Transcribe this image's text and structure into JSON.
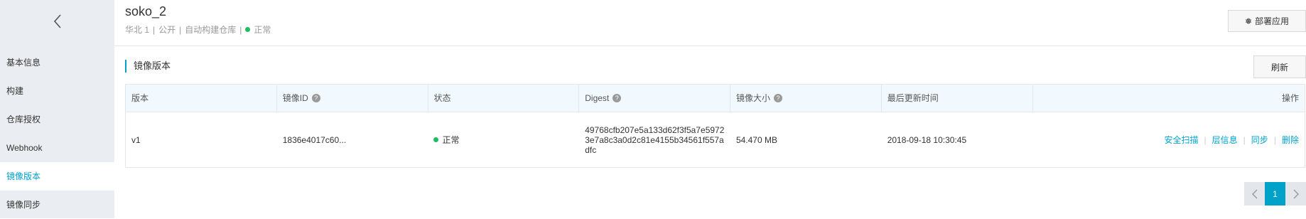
{
  "sidebar": {
    "items": [
      {
        "label": "基本信息"
      },
      {
        "label": "构建"
      },
      {
        "label": "仓库授权"
      },
      {
        "label": "Webhook"
      },
      {
        "label": "镜像版本"
      },
      {
        "label": "镜像同步"
      }
    ],
    "active_index": 4
  },
  "header": {
    "title": "soko_2",
    "region": "华北 1",
    "visibility": "公开",
    "build_type": "自动构建仓库",
    "status": "正常",
    "separator": "|",
    "deploy_label": "部署应用"
  },
  "section": {
    "title": "镜像版本",
    "refresh_label": "刷新"
  },
  "table": {
    "headers": [
      "版本",
      "镜像ID",
      "状态",
      "Digest",
      "镜像大小",
      "最后更新时间",
      "操作"
    ],
    "rows": [
      {
        "version": "v1",
        "image_id": "1836e4017c60...",
        "status": "正常",
        "digest": "49768cfb207e5a133d62f3f5a7e59723e7a8c3a0d2c81e4155b34561f557adfc",
        "size": "54.470 MB",
        "updated": "2018-09-18 10:30:45",
        "actions": [
          "安全扫描",
          "层信息",
          "同步",
          "删除"
        ]
      }
    ]
  },
  "pagination": {
    "current": "1"
  },
  "colors": {
    "accent": "#00a2ca",
    "status_ok": "#1ebd5f",
    "sidebar_bg": "#eaedf1",
    "table_header_bg": "#f2f9fe"
  },
  "icons": [
    "back-chevron-icon",
    "deploy-icon",
    "help-icon",
    "status-dot-icon",
    "prev-page-icon",
    "next-page-icon"
  ]
}
